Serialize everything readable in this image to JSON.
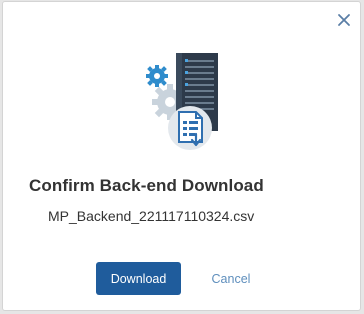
{
  "dialog": {
    "title": "Confirm Back-end Download",
    "filename": "MP_Backend_221117110324.csv",
    "close_icon": "close-icon",
    "illustration_icons": [
      "gear-icon",
      "server-icon",
      "document-download-icon"
    ],
    "buttons": {
      "download_label": "Download",
      "cancel_label": "Cancel"
    },
    "colors": {
      "primary": "#1f5c9c",
      "link": "#5f8fbd",
      "icon_blue": "#2f8ccc",
      "server_dark": "#2d3a4a"
    }
  }
}
